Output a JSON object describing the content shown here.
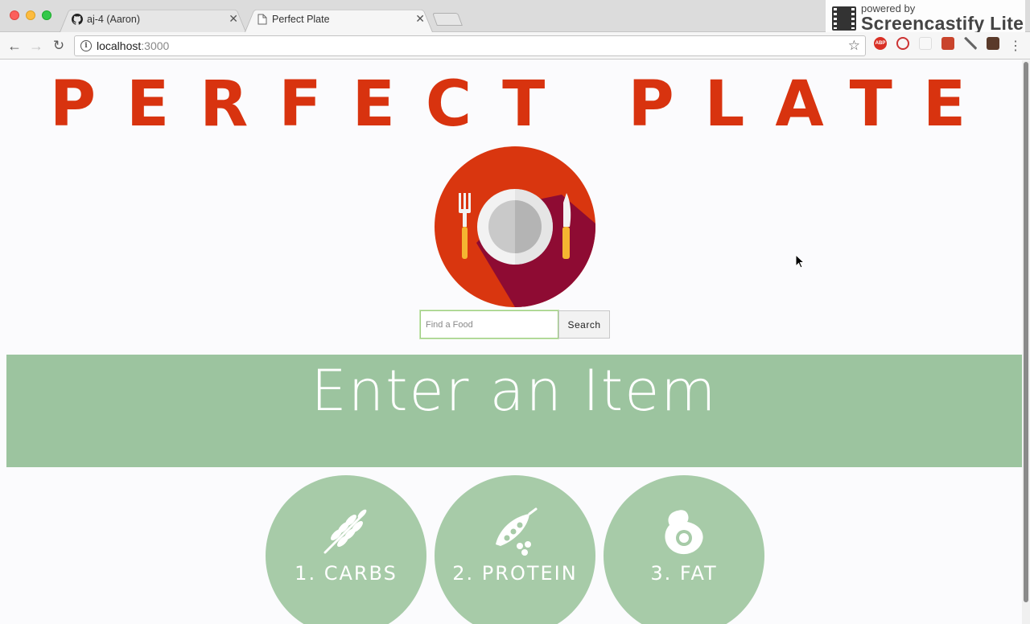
{
  "browser": {
    "tabs": [
      {
        "title": "aj-4 (Aaron)",
        "icon": "github-icon",
        "active": false
      },
      {
        "title": "Perfect Plate",
        "icon": "page-icon",
        "active": true
      }
    ],
    "url_host": "localhost",
    "url_port": ":3000",
    "recorder": {
      "tagline": "powered by",
      "name": "Screencastify Lite"
    }
  },
  "site": {
    "title": "PERFECT PLATE",
    "search": {
      "placeholder": "Find a Food",
      "value": "",
      "button_label": "Search"
    },
    "banner_text": "Enter an Item",
    "macros": [
      {
        "label": "1. CARBS",
        "icon": "wheat-icon"
      },
      {
        "label": "2. PROTEIN",
        "icon": "peas-icon"
      },
      {
        "label": "3. FAT",
        "icon": "egg-icon"
      }
    ]
  },
  "colors": {
    "title_red": "#d8330f",
    "logo_red": "#d9360f",
    "logo_shadow": "#8e0b33",
    "banner_green": "#9cc49f",
    "circle_green": "#a7cba8"
  }
}
